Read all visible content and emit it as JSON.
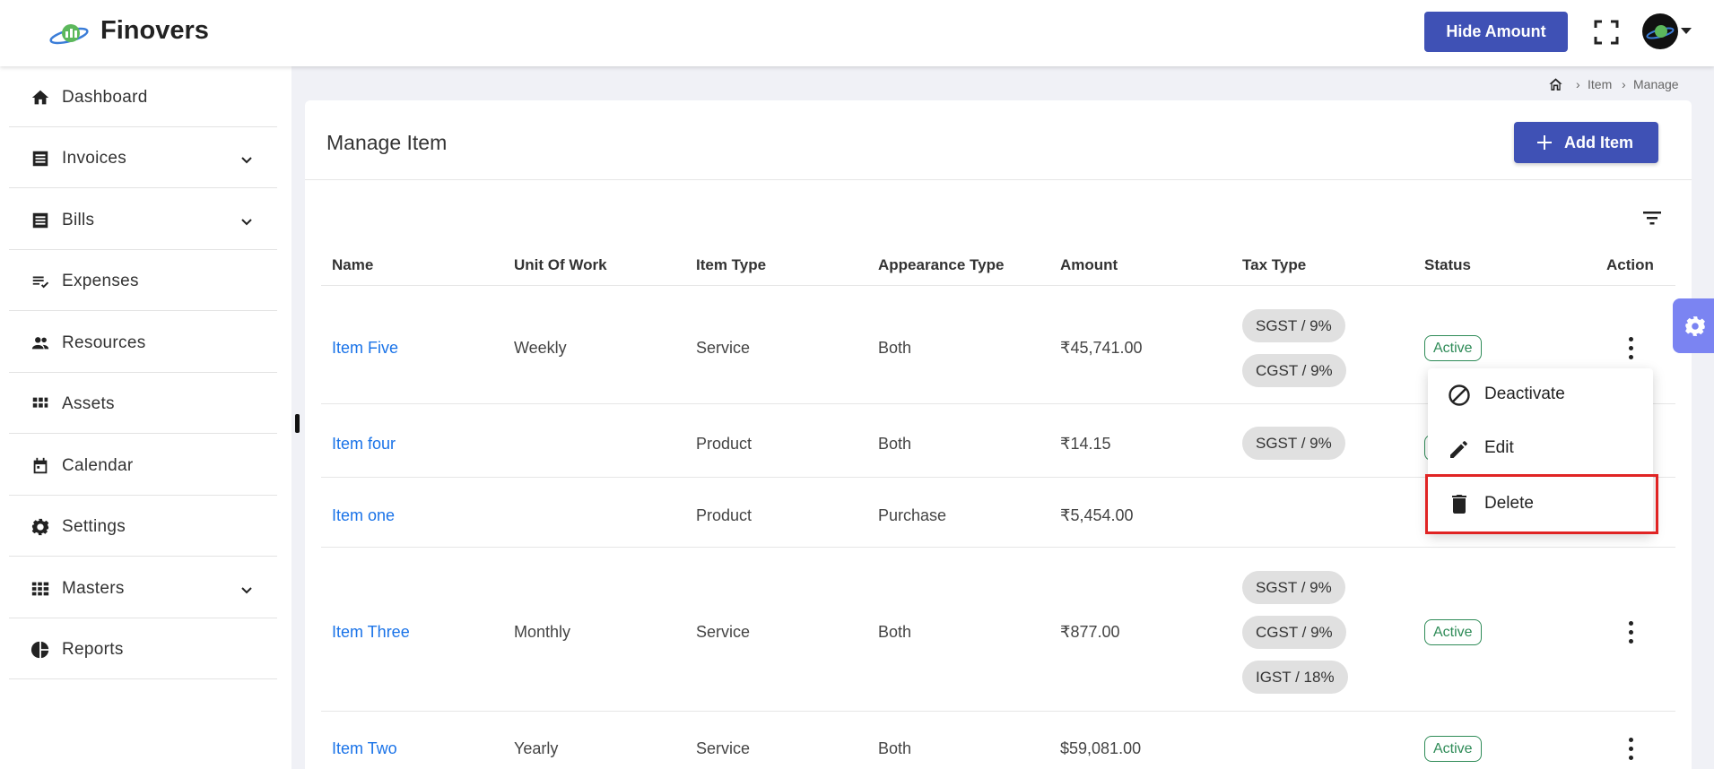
{
  "header": {
    "brand": "Finovers",
    "hide_amount_label": "Hide Amount"
  },
  "sidebar": {
    "items": [
      {
        "label": "Dashboard",
        "icon": "home-icon"
      },
      {
        "label": "Invoices",
        "icon": "invoice-icon",
        "expandable": true
      },
      {
        "label": "Bills",
        "icon": "bill-icon",
        "expandable": true
      },
      {
        "label": "Expenses",
        "icon": "expenses-icon"
      },
      {
        "label": "Resources",
        "icon": "people-icon"
      },
      {
        "label": "Assets",
        "icon": "grid-icon"
      },
      {
        "label": "Calendar",
        "icon": "calendar-icon"
      },
      {
        "label": "Settings",
        "icon": "gear-icon"
      },
      {
        "label": "Masters",
        "icon": "apps-icon",
        "expandable": true
      },
      {
        "label": "Reports",
        "icon": "pie-chart-icon"
      }
    ]
  },
  "breadcrumb": {
    "items": [
      "Item",
      "Manage"
    ]
  },
  "page": {
    "title": "Manage Item",
    "add_button": "Add Item"
  },
  "table": {
    "columns": [
      "Name",
      "Unit Of Work",
      "Item Type",
      "Appearance Type",
      "Amount",
      "Tax Type",
      "Status",
      "Action"
    ],
    "rows": [
      {
        "name": "Item Five",
        "unit": "Weekly",
        "type": "Service",
        "appearance": "Both",
        "amount": "₹45,741.00",
        "taxes": [
          "SGST / 9%",
          "CGST / 9%"
        ],
        "status": "Active"
      },
      {
        "name": "Item four",
        "unit": "",
        "type": "Product",
        "appearance": "Both",
        "amount": "₹14.15",
        "taxes": [
          "SGST / 9%"
        ],
        "status": ""
      },
      {
        "name": "Item one",
        "unit": "",
        "type": "Product",
        "appearance": "Purchase",
        "amount": "₹5,454.00",
        "taxes": [],
        "status": ""
      },
      {
        "name": "Item Three",
        "unit": "Monthly",
        "type": "Service",
        "appearance": "Both",
        "amount": "₹877.00",
        "taxes": [
          "SGST / 9%",
          "CGST / 9%",
          "IGST / 18%"
        ],
        "status": "Active"
      },
      {
        "name": "Item Two",
        "unit": "Yearly",
        "type": "Service",
        "appearance": "Both",
        "amount": "$59,081.00",
        "taxes": [],
        "status": "Active"
      }
    ]
  },
  "action_menu": {
    "items": [
      {
        "label": "Deactivate",
        "icon": "block-icon"
      },
      {
        "label": "Edit",
        "icon": "pencil-icon"
      },
      {
        "label": "Delete",
        "icon": "trash-icon",
        "highlighted": true
      }
    ]
  },
  "colors": {
    "primary": "#3f51b5",
    "link": "#1a73e8",
    "active_status": "#2e8b57",
    "highlight_outline": "#e02424"
  }
}
